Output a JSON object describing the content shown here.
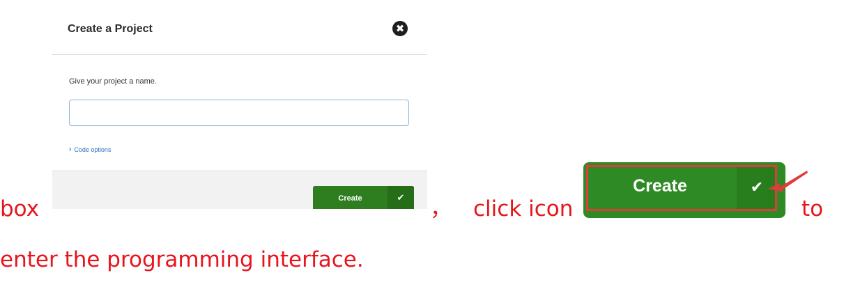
{
  "dialog": {
    "title": "Create a Project",
    "close_icon": "✖",
    "prompt": "Give your project a name.",
    "name_input_value": "",
    "code_options_label": "Code options",
    "chevron_icon": "›",
    "create_label": "Create",
    "check_icon": "✔"
  },
  "instruction": {
    "part1": "box",
    "comma": "，",
    "part2": "click icon",
    "part3": "to",
    "line2": "enter the programming interface."
  },
  "big_button": {
    "label": "Create",
    "check_icon": "✔"
  },
  "colors": {
    "instruction_text": "#e8141c",
    "button_green": "#2e8a24",
    "highlight_red": "#e23b3b"
  }
}
